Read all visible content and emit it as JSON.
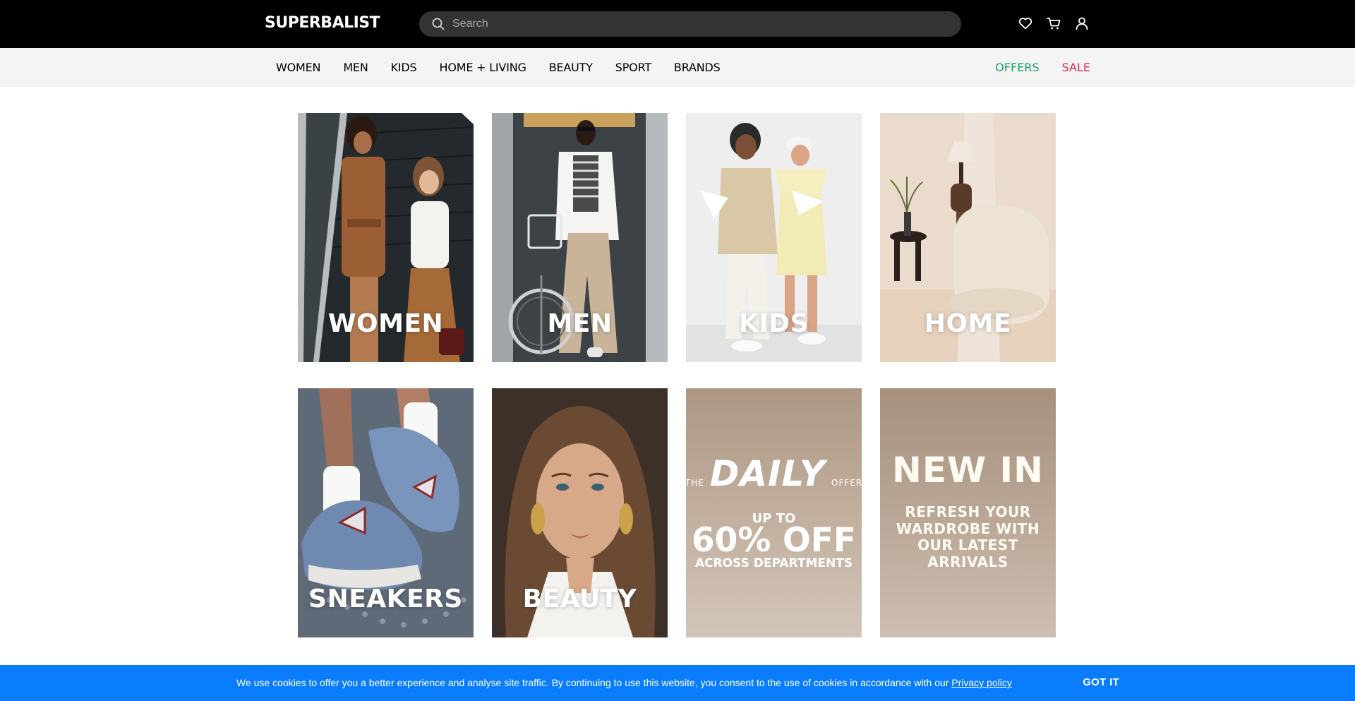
{
  "header": {
    "logo": "SUPERBALIST",
    "search_placeholder": "Search",
    "icons": [
      "heart-icon",
      "cart-icon",
      "user-icon"
    ]
  },
  "nav": {
    "items": [
      "WOMEN",
      "MEN",
      "KIDS",
      "HOME + LIVING",
      "BEAUTY",
      "SPORT",
      "BRANDS"
    ],
    "offers": "OFFERS",
    "sale": "SALE",
    "offers_color": "#15a35c",
    "sale_color": "#e0284b"
  },
  "tiles": [
    {
      "label": "WOMEN"
    },
    {
      "label": "MEN"
    },
    {
      "label": "KIDS"
    },
    {
      "label": "HOME"
    },
    {
      "label": "SNEAKERS"
    },
    {
      "label": "BEAUTY"
    }
  ],
  "daily_offer": {
    "the": "THE",
    "daily": "DAILY",
    "offer": "OFFER",
    "up_to": "UP TO",
    "discount": "60% OFF",
    "across": "ACROSS DEPARTMENTS"
  },
  "new_in": {
    "title": "NEW IN",
    "text": "REFRESH YOUR WARDROBE WITH OUR LATEST ARRIVALS"
  },
  "cookie": {
    "text": "We use cookies to offer you a better experience and analyse site traffic. By continuing to use this website, you consent to the use of cookies in accordance with our",
    "link": "Privacy policy",
    "button": "GOT IT",
    "bg_color": "#0a7dff"
  }
}
